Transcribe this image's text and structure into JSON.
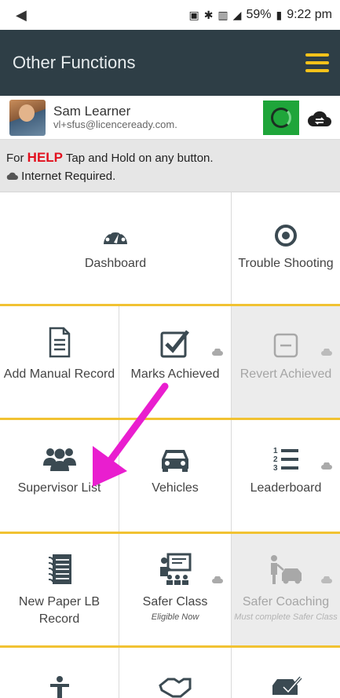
{
  "status_bar": {
    "battery": "59%",
    "time": "9:22 pm"
  },
  "app_bar": {
    "title": "Other Functions"
  },
  "user": {
    "name": "Sam Learner",
    "email": "vl+sfus@licenceready.com."
  },
  "help": {
    "prefix": "For ",
    "keyword": "HELP",
    "rest": " Tap and Hold on any button.",
    "internet": "Internet Required."
  },
  "tiles": {
    "dashboard": {
      "label": "Dashboard"
    },
    "trouble_shooting": {
      "label": "Trouble Shooting"
    },
    "add_manual_record": {
      "label": "Add Manual Record"
    },
    "marks_achieved": {
      "label": "Marks Achieved"
    },
    "revert_achieved": {
      "label": "Revert Achieved"
    },
    "supervisor_list": {
      "label": "Supervisor List"
    },
    "vehicles": {
      "label": "Vehicles"
    },
    "leaderboard": {
      "label": "Leaderboard"
    },
    "new_paper_lb_record": {
      "label": "New Paper LB Record"
    },
    "safer_class": {
      "label": "Safer Class",
      "sub": "Eligible Now"
    },
    "safer_coaching": {
      "label": "Safer Coaching",
      "sub": "Must complete Safer Class"
    }
  },
  "colors": {
    "app_bar": "#2e3e46",
    "accent_yellow": "#f1c232",
    "help_red": "#e2101e",
    "sync_green": "#1fa53a",
    "annotation_arrow": "#e91ecf"
  }
}
